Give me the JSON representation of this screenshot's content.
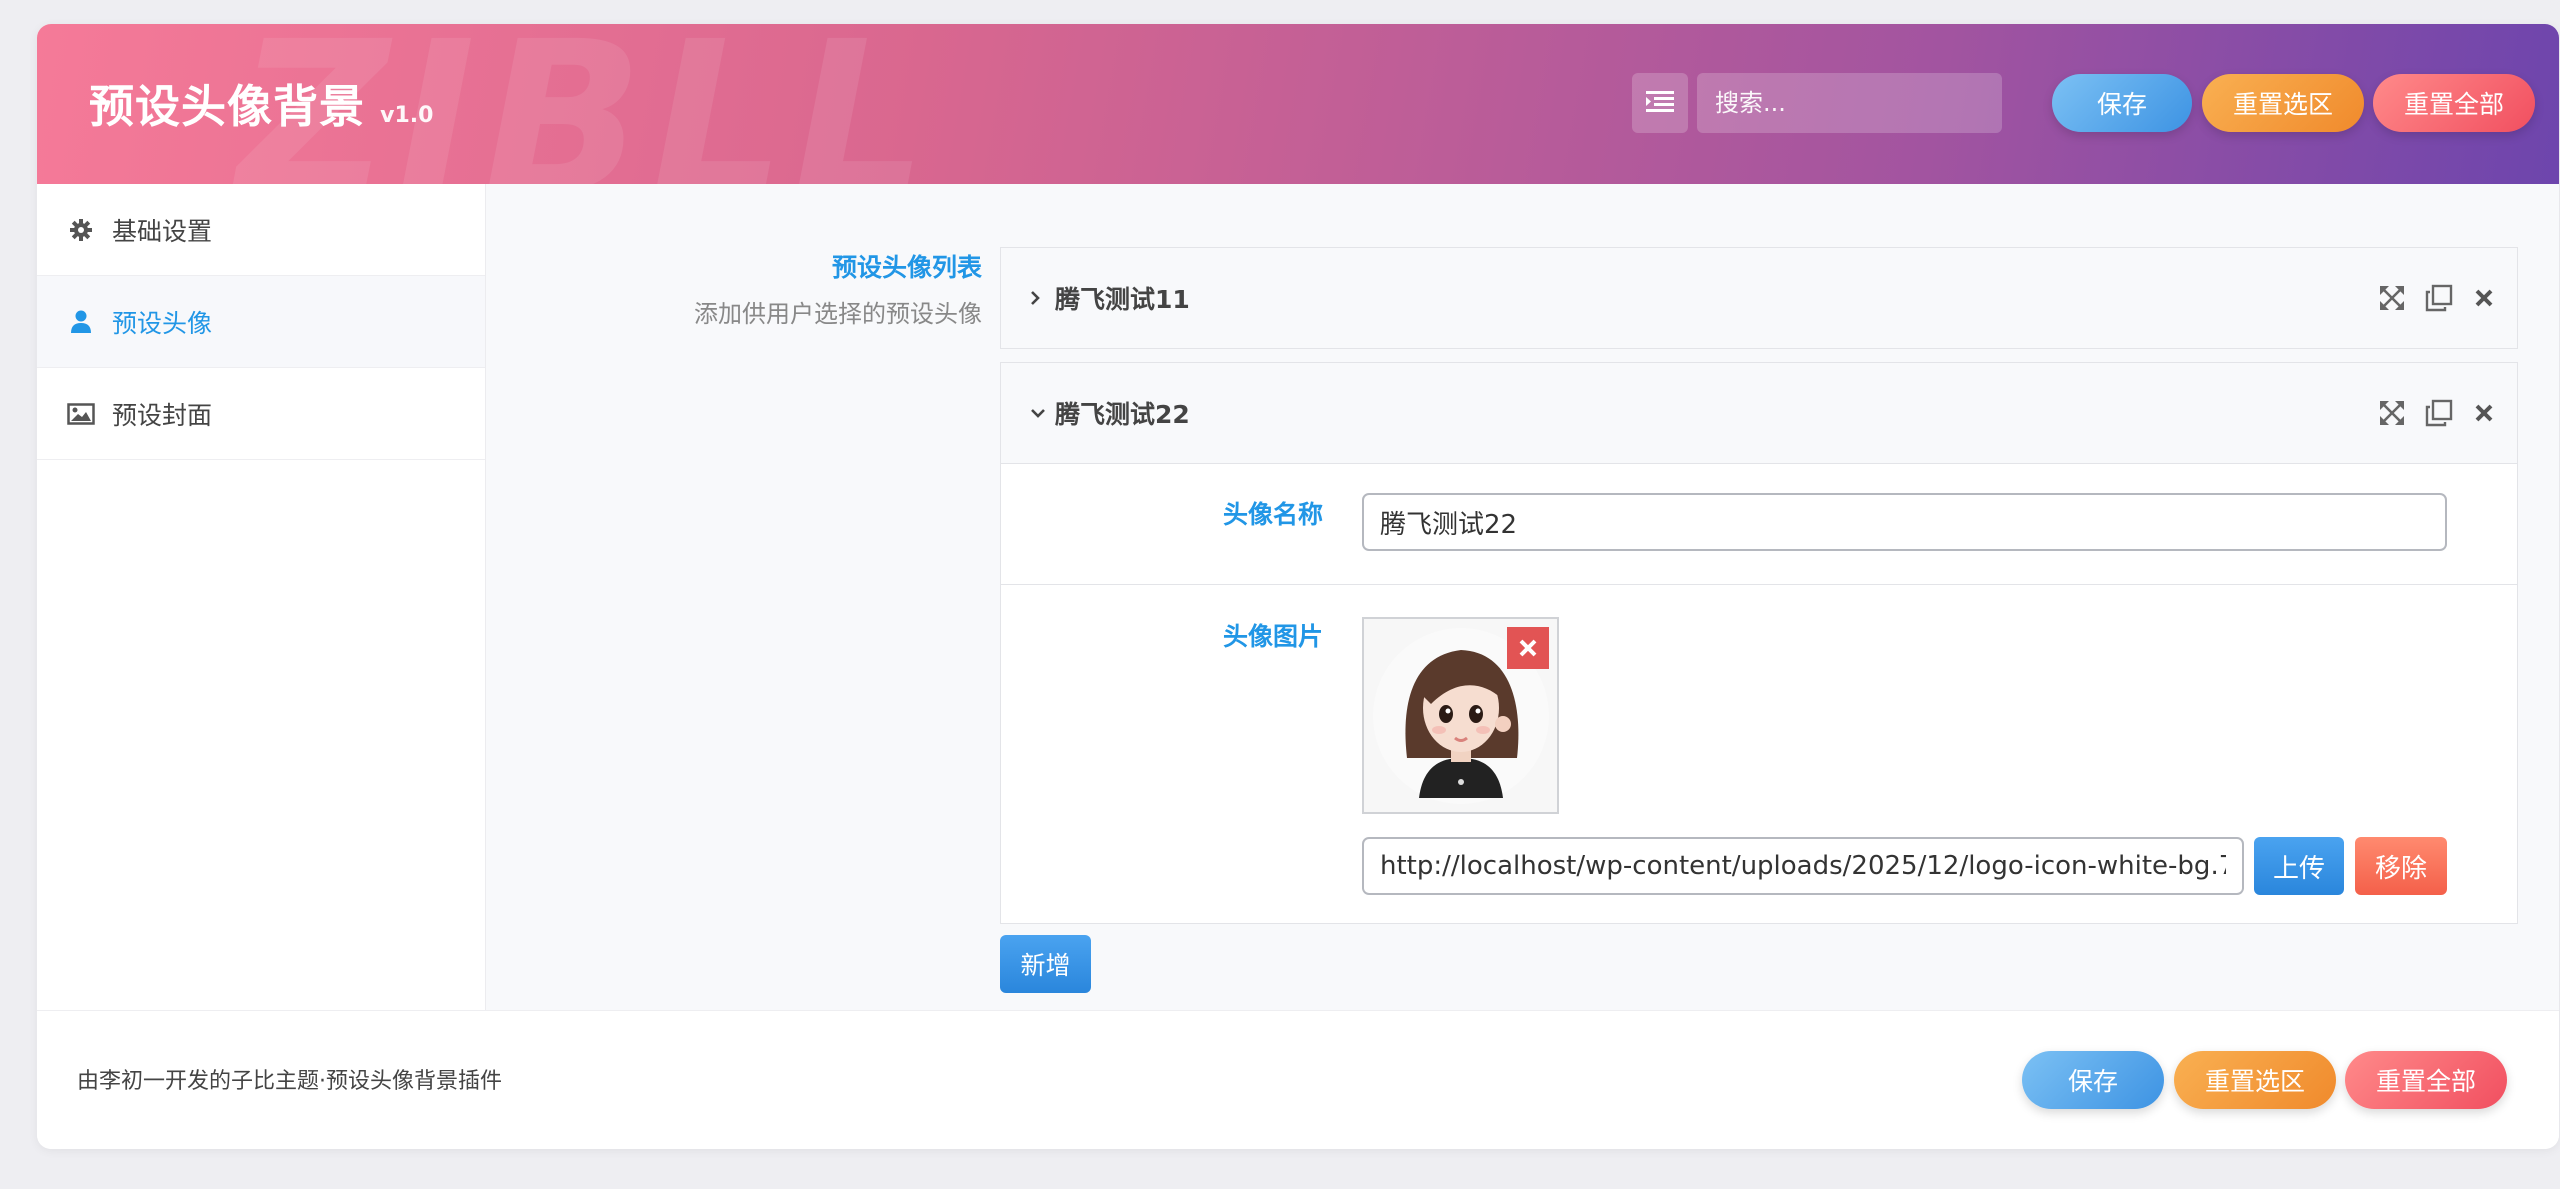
{
  "header": {
    "title": "预设头像背景",
    "version": "v1.0",
    "watermark": "ZIBLL",
    "search_placeholder": "搜索...",
    "buttons": {
      "save": "保存",
      "reset_section": "重置选区",
      "reset_all": "重置全部"
    }
  },
  "sidebar": {
    "items": [
      {
        "label": "基础设置",
        "icon": "gear-icon",
        "active": false
      },
      {
        "label": "预设头像",
        "icon": "user-icon",
        "active": true
      },
      {
        "label": "预设封面",
        "icon": "image-icon",
        "active": false
      }
    ]
  },
  "main": {
    "field_title": "预设头像列表",
    "field_desc": "添加供用户选择的预设头像",
    "groups": [
      {
        "title": "腾飞测试11",
        "expanded": false
      },
      {
        "title": "腾飞测试22",
        "expanded": true,
        "name_label": "头像名称",
        "name_value": "腾飞测试22",
        "image_label": "头像图片",
        "image_url": "http://localhost/wp-content/uploads/2025/12/logo-icon-white-bg.7",
        "upload_label": "上传",
        "remove_label": "移除"
      }
    ],
    "add_label": "新增"
  },
  "footer": {
    "text": "由李初一开发的子比主题·预设头像背景插件",
    "buttons": {
      "save": "保存",
      "reset_section": "重置选区",
      "reset_all": "重置全部"
    }
  },
  "colors": {
    "accent": "#2196e6",
    "save": "#4a9fe8",
    "reset_section": "#f39a3a",
    "reset_all": "#f3606a"
  }
}
